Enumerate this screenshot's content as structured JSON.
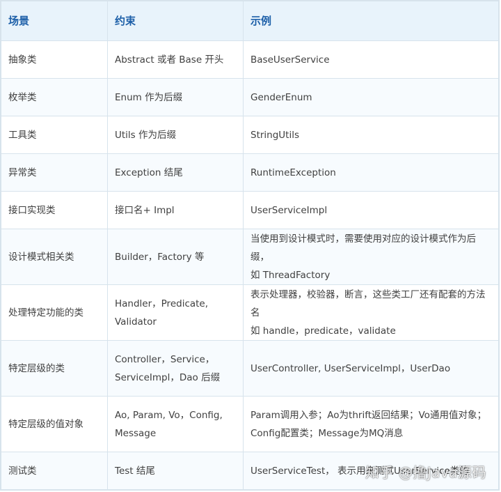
{
  "table": {
    "headers": [
      "场景",
      "约束",
      "示例"
    ],
    "rows": [
      {
        "scene": "抽象类",
        "constraint": "Abstract 或者 Base 开头",
        "example": "BaseUserService"
      },
      {
        "scene": "枚举类",
        "constraint": "Enum 作为后缀",
        "example": "GenderEnum"
      },
      {
        "scene": "工具类",
        "constraint": "Utils 作为后缀",
        "example": "StringUtils"
      },
      {
        "scene": "异常类",
        "constraint": "Exception 结尾",
        "example": "RuntimeException"
      },
      {
        "scene": "接口实现类",
        "constraint": "接口名+ Impl",
        "example": "UserServiceImpl"
      },
      {
        "scene": "设计模式相关类",
        "constraint": "Builder，Factory 等",
        "example": "当使用到设计模式时，需要使用对应的设计模式作为后缀，\n如 ThreadFactory"
      },
      {
        "scene": "处理特定功能的类",
        "constraint": "Handler，Predicate,\nValidator",
        "example": "表示处理器，校验器，断言，这些类工厂还有配套的方法名\n如 handle，predicate，validate"
      },
      {
        "scene": "特定层级的类",
        "constraint": "Controller，Service，\nServiceImpl，Dao 后缀",
        "example": "UserController, UserServiceImpl，UserDao"
      },
      {
        "scene": "特定层级的值对象",
        "constraint": "Ao, Param, Vo，Config,\nMessage",
        "example": "Param调用入参；Ao为thrift返回结果；Vo通用值对象；\nConfig配置类；Message为MQ消息"
      },
      {
        "scene": "测试类",
        "constraint": "Test 结尾",
        "example": "UserServiceTest， 表示用来测试UserService类的"
      }
    ]
  },
  "watermark": "知乎 @撸Java源码"
}
